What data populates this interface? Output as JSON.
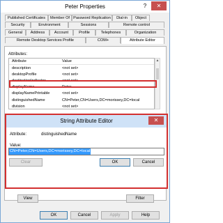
{
  "window": {
    "title": "Peter Properties",
    "help_glyph": "?",
    "close_glyph": "✕"
  },
  "tabs": {
    "row1": [
      "Published Certificates",
      "Member Of",
      "Password Replication",
      "Dial-in",
      "Object"
    ],
    "row2": [
      "Security",
      "Environment",
      "Sessions",
      "Remote control"
    ],
    "row3": [
      "General",
      "Address",
      "Account",
      "Profile",
      "Telephones",
      "Organization"
    ],
    "row4": [
      "Remote Desktop Services Profile",
      "COM+",
      "Attribute Editor"
    ]
  },
  "attributes": {
    "label": "Attributes:",
    "col_attribute": "Attribute",
    "col_value": "Value",
    "rows": [
      {
        "attr": "description",
        "value": "<not set>"
      },
      {
        "attr": "desktopProfile",
        "value": "<not set>"
      },
      {
        "attr": "destinationIndicator",
        "value": "<not set>"
      },
      {
        "attr": "displayName",
        "value": "Peter"
      },
      {
        "attr": "displayNamePrintable",
        "value": "<not set>"
      },
      {
        "attr": "distinguishedName",
        "value": "CN=Peter,CN=Users,DC=morissey,DC=local"
      },
      {
        "attr": "division",
        "value": "<not set>"
      }
    ],
    "highlight_color": "#d32f2f"
  },
  "dialog": {
    "title": "String Attribute Editor",
    "close_glyph": "✕",
    "attribute_label": "Attribute:",
    "attribute_value": "distinguishedName",
    "value_label": "Value:",
    "value_text": "CN=Peter,CN=Users,DC=morissey,DC=local",
    "clear_label": "Clear",
    "ok_label": "OK",
    "cancel_label": "Cancel"
  },
  "panel_buttons": {
    "view_label": "View",
    "filter_label": "Filter"
  },
  "bottom_buttons": {
    "ok_label": "OK",
    "cancel_label": "Cancel",
    "apply_label": "Apply",
    "help_label": "Help"
  },
  "colors": {
    "selection": "#3399ff",
    "accent_red": "#d32f2f",
    "dialog_title_bg": "#cfe2f7"
  }
}
